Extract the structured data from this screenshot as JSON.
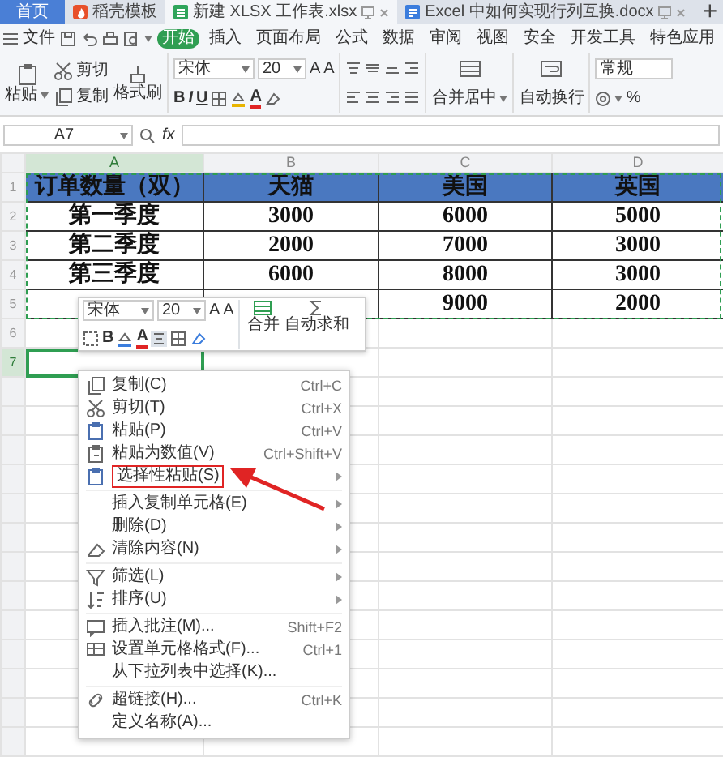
{
  "tabs": [
    {
      "label": "首页",
      "kind": "home",
      "selected": false
    },
    {
      "label": "稻壳模板",
      "kind": "docer",
      "selected": false
    },
    {
      "label": "新建 XLSX 工作表.xlsx",
      "kind": "sheet",
      "selected": true
    },
    {
      "label": "Excel 中如何实现行列互换.docx",
      "kind": "doc",
      "selected": false
    }
  ],
  "new_tab": "+",
  "menu": {
    "file": "文件",
    "items": [
      {
        "label": "开始",
        "selected": true
      },
      {
        "label": "插入",
        "selected": false
      },
      {
        "label": "页面布局",
        "selected": false
      },
      {
        "label": "公式",
        "selected": false
      },
      {
        "label": "数据",
        "selected": false
      },
      {
        "label": "审阅",
        "selected": false
      },
      {
        "label": "视图",
        "selected": false
      },
      {
        "label": "安全",
        "selected": false
      },
      {
        "label": "开发工具",
        "selected": false
      },
      {
        "label": "特色应用",
        "selected": false
      }
    ]
  },
  "ribbon": {
    "paste": "粘贴",
    "cut": "剪切",
    "copy": "复制",
    "format_painter": "格式刷",
    "font": "宋体",
    "size": "20",
    "grow": "A",
    "shrink": "A",
    "bold": "B",
    "italic": "I",
    "underline": "U",
    "font_color": "A",
    "merge": "合并居中",
    "wrap": "自动换行",
    "number_format": "常规",
    "percent": "%"
  },
  "formula_bar": {
    "cell": "A7",
    "fx": "fx"
  },
  "sheet": {
    "copied": true,
    "columns": [
      {
        "label": "A",
        "selected": true
      },
      {
        "label": "B",
        "selected": false
      },
      {
        "label": "C",
        "selected": false
      },
      {
        "label": "D",
        "selected": false
      }
    ],
    "rows": [
      {
        "number": "1",
        "kind": "header",
        "selected": false,
        "cells": [
          "订单数量（双）",
          "天猫",
          "美国",
          "英国"
        ]
      },
      {
        "number": "2",
        "kind": "data",
        "selected": false,
        "cells": [
          "第一季度",
          "3000",
          "6000",
          "5000"
        ]
      },
      {
        "number": "3",
        "kind": "data",
        "selected": false,
        "cells": [
          "第二季度",
          "2000",
          "7000",
          "3000"
        ]
      },
      {
        "number": "4",
        "kind": "data",
        "selected": false,
        "cells": [
          "第三季度",
          "6000",
          "8000",
          "3000"
        ]
      },
      {
        "number": "5",
        "kind": "data",
        "selected": false,
        "cells": [
          null,
          null,
          "9000",
          "2000"
        ]
      },
      {
        "number": "6",
        "kind": "blank",
        "selected": false
      },
      {
        "number": "7",
        "kind": "blank",
        "selected": true
      }
    ]
  },
  "mini_toolbar": {
    "font": "宋体",
    "size": "20",
    "grow": "A",
    "shrink": "A",
    "bold": "B",
    "font_color": "A",
    "merge": "合并",
    "autosum": "自动求和"
  },
  "context_menu": {
    "groups": [
      [
        {
          "label": "复制(C)",
          "shortcut": "Ctrl+C",
          "kind": "copy",
          "submenu": false,
          "highlighted": false
        },
        {
          "label": "剪切(T)",
          "shortcut": "Ctrl+X",
          "kind": "cut",
          "submenu": false,
          "highlighted": false
        },
        {
          "label": "粘贴(P)",
          "shortcut": "Ctrl+V",
          "kind": "paste",
          "submenu": false,
          "highlighted": false
        },
        {
          "label": "粘贴为数值(V)",
          "shortcut": "Ctrl+Shift+V",
          "kind": "paste_values",
          "submenu": false,
          "highlighted": false
        },
        {
          "label": "选择性粘贴(S)",
          "kind": "paste",
          "submenu": true,
          "highlighted": true
        }
      ],
      [
        {
          "label": "插入复制单元格(E)",
          "submenu": true,
          "highlighted": false
        },
        {
          "label": "删除(D)",
          "submenu": true,
          "highlighted": false
        },
        {
          "label": "清除内容(N)",
          "kind": "eraser",
          "submenu": true,
          "highlighted": false
        }
      ],
      [
        {
          "label": "筛选(L)",
          "kind": "filter",
          "submenu": true,
          "highlighted": false
        },
        {
          "label": "排序(U)",
          "kind": "sort",
          "submenu": true,
          "highlighted": false
        }
      ],
      [
        {
          "label": "插入批注(M)...",
          "shortcut": "Shift+F2",
          "kind": "comment",
          "submenu": false,
          "highlighted": false
        },
        {
          "label": "设置单元格格式(F)...",
          "shortcut": "Ctrl+1",
          "kind": "format",
          "submenu": false,
          "highlighted": false
        },
        {
          "label": "从下拉列表中选择(K)...",
          "submenu": false,
          "highlighted": false
        }
      ],
      [
        {
          "label": "超链接(H)...",
          "shortcut": "Ctrl+K",
          "kind": "link",
          "submenu": false,
          "highlighted": false
        },
        {
          "label": "定义名称(A)...",
          "submenu": false,
          "highlighted": false
        }
      ]
    ]
  },
  "annotation": {
    "kind": "arrow",
    "color": "#e02424"
  }
}
